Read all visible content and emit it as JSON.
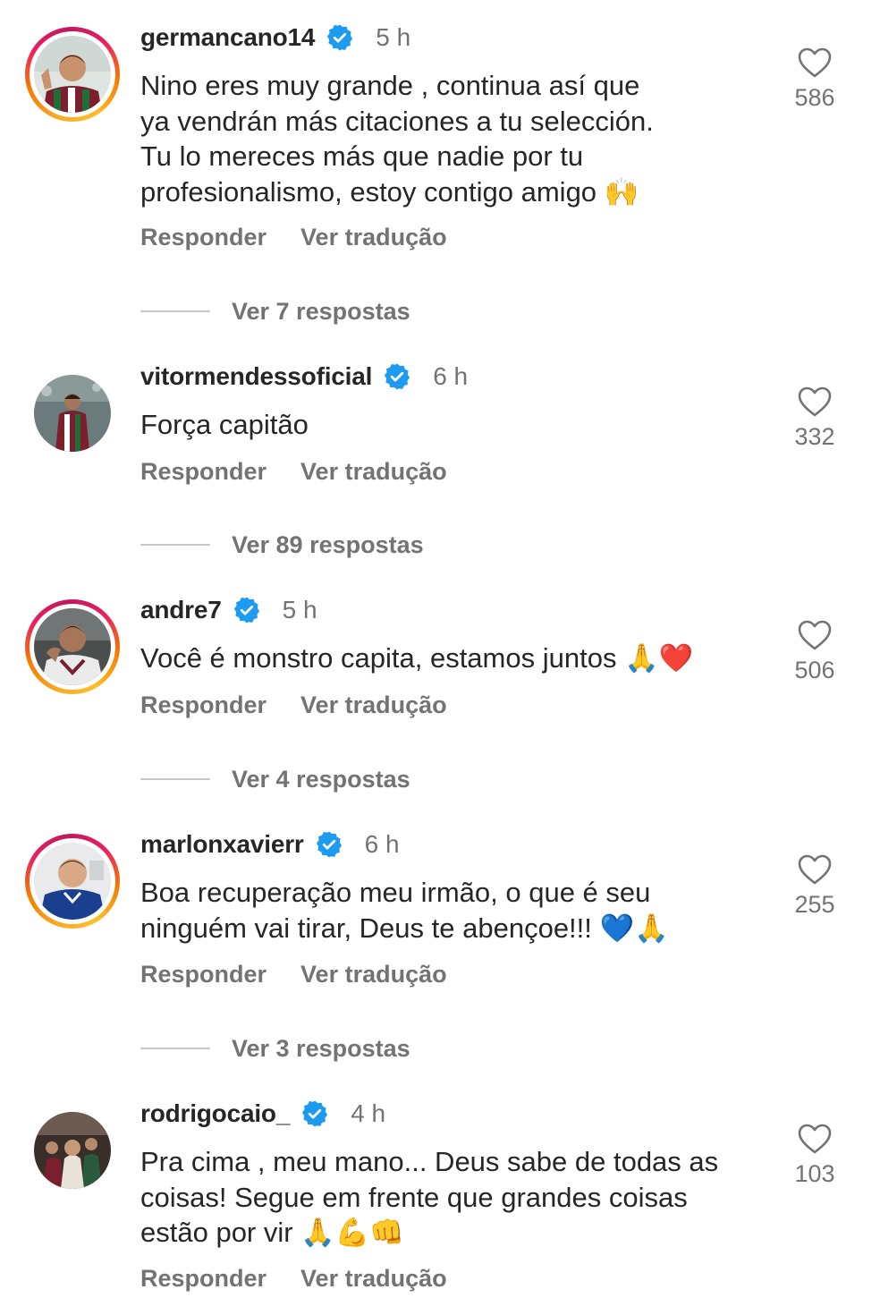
{
  "comments": [
    {
      "username": "germancano14",
      "time": "5 h",
      "text": "Nino eres muy grande , continua así que\nya vendrán más citaciones a tu selección.\nTu lo mereces más que nadie por tu\nprofesionalismo, estoy contigo amigo 🙌",
      "reply_label": "Responder",
      "translate_label": "Ver tradução",
      "likes": "586",
      "view_replies": "Ver 7 respostas",
      "has_story": true
    },
    {
      "username": "vitormendessoficial",
      "time": "6 h",
      "text": "Força capitão",
      "reply_label": "Responder",
      "translate_label": "Ver tradução",
      "likes": "332",
      "view_replies": "Ver 89 respostas",
      "has_story": false
    },
    {
      "username": "andre7",
      "time": "5 h",
      "text": "Você é monstro capita, estamos juntos 🙏❤️",
      "reply_label": "Responder",
      "translate_label": "Ver tradução",
      "likes": "506",
      "view_replies": "Ver 4 respostas",
      "has_story": true
    },
    {
      "username": "marlonxavierr",
      "time": "6 h",
      "text": "Boa recuperação meu irmão, o que é seu\nninguém vai tirar, Deus te abençoe!!! 💙🙏",
      "reply_label": "Responder",
      "translate_label": "Ver tradução",
      "likes": "255",
      "view_replies": "Ver 3 respostas",
      "has_story": true
    },
    {
      "username": "rodrigocaio_",
      "time": "4 h",
      "text": "Pra cima , meu mano... Deus sabe de todas as\ncoisas! Segue em frente que grandes coisas\nestão por vir 🙏💪👊",
      "reply_label": "Responder",
      "translate_label": "Ver tradução",
      "likes": "103",
      "has_story": false
    }
  ],
  "colors": {
    "verified": "#1d9bf0",
    "secondary_text": "#737373",
    "primary_text": "#262626",
    "story_ring": "#e91e63"
  },
  "icons": {
    "verified": "verified-badge-icon",
    "like": "heart-outline-icon"
  }
}
